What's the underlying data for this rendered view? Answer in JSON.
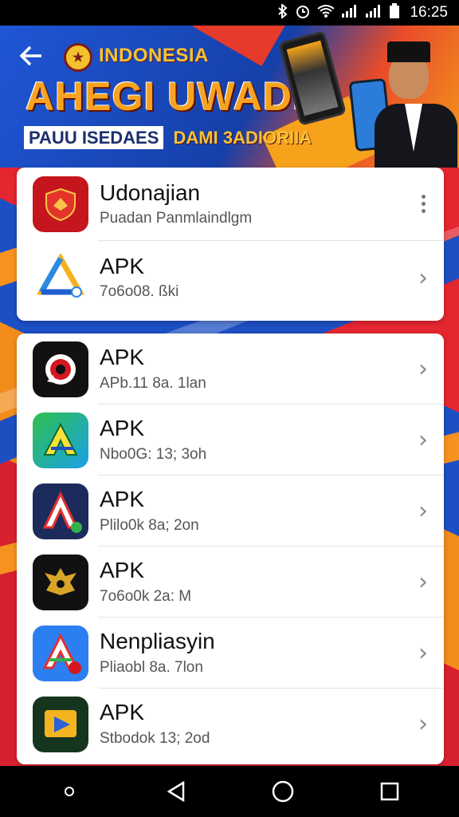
{
  "status_bar": {
    "time": "16:25",
    "icons": [
      "bluetooth-icon",
      "alarm-icon",
      "wifi-icon",
      "signal-icon",
      "signal-icon-2",
      "battery-icon"
    ]
  },
  "banner": {
    "brand": "INDONESIA",
    "title": "AHEGI UWADIA",
    "subtitle_a": "PAUU ISEDAES",
    "subtitle_b": "DAMI 3ADIORIIA",
    "back_icon": "back-arrow-icon"
  },
  "top_card": {
    "items": [
      {
        "title": "Udonajian",
        "subtitle": "Puadan Panmlaindlgm",
        "icon": "red-shield-app-icon",
        "action": "more-options"
      },
      {
        "title": "APK",
        "subtitle": "7o6o08. ßki",
        "icon": "triangle-logo-app-icon",
        "action": "chevron"
      }
    ]
  },
  "list_card": {
    "items": [
      {
        "title": "APK",
        "subtitle": "APb.11 8a. 1lan",
        "icon": "red-circle-app-icon"
      },
      {
        "title": "APK",
        "subtitle": "Nbo0G: 13; 3oh",
        "icon": "green-a-app-icon"
      },
      {
        "title": "APK",
        "subtitle": "Plilo0k 8a; 2on",
        "icon": "navy-a-app-icon"
      },
      {
        "title": "APK",
        "subtitle": "7o6o0k 2a: M",
        "icon": "garuda-app-icon"
      },
      {
        "title": "Nenpliasyin",
        "subtitle": "Pliaobl 8a. 7lon",
        "icon": "blue-a-app-icon"
      },
      {
        "title": "APK",
        "subtitle": "Stbodok 13; 2od",
        "icon": "play-app-icon"
      }
    ]
  },
  "nav_bar": {
    "buttons": [
      "recents-dot-icon",
      "back-triangle-icon",
      "home-circle-icon",
      "overview-square-icon"
    ]
  }
}
